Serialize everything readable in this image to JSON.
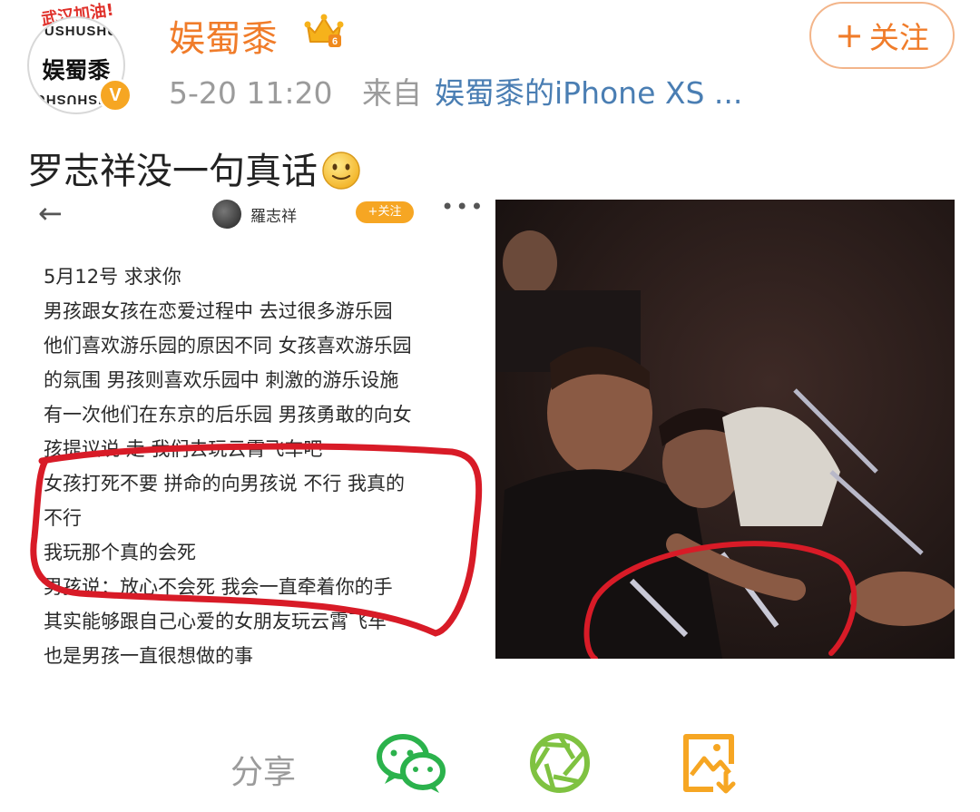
{
  "header": {
    "avatar_banner": "武汉加油!",
    "avatar_ring_text": "YUSHUSHU",
    "avatar_text": "娱蜀黍",
    "verified_badge": "V",
    "username": "娱蜀黍",
    "timestamp": "5-20 11:20",
    "source_prefix": "来自",
    "source": "娱蜀黍的iPhone XS ...",
    "follow_plus": "+",
    "follow_label": "关注"
  },
  "post": {
    "text": "罗志祥没一句真话"
  },
  "embedded_screenshot": {
    "back_glyph": "←",
    "author": "羅志祥",
    "follow_label": "+关注",
    "more_glyph": "•••",
    "lines": [
      "5月12号  求求你",
      "男孩跟女孩在恋爱过程中 去过很多游乐园",
      "他们喜欢游乐园的原因不同 女孩喜欢游乐园",
      "的氛围 男孩则喜欢乐园中 刺激的游乐设施",
      "有一次他们在东京的后乐园 男孩勇敢的向女",
      "孩提议说 走 我们去玩云霄飞车吧",
      "女孩打死不要 拼命的向男孩说 不行 我真的",
      "不行",
      "我玩那个真的会死",
      "男孩说：放心不会死 我会一直牵着你的手",
      "其实能够跟自己心爱的女朋友玩云霄飞车",
      "也是男孩一直很想做的事"
    ]
  },
  "share": {
    "label": "分享",
    "icons": [
      "wechat-icon",
      "moments-icon",
      "save-image-icon"
    ]
  },
  "colors": {
    "accent": "#f07c2a",
    "link": "#4a7eb3",
    "meta": "#9b9b9b",
    "wechat": "#2bb24c",
    "moments": "#7fc241",
    "save": "#f6a623",
    "annotation": "#d81b27"
  }
}
